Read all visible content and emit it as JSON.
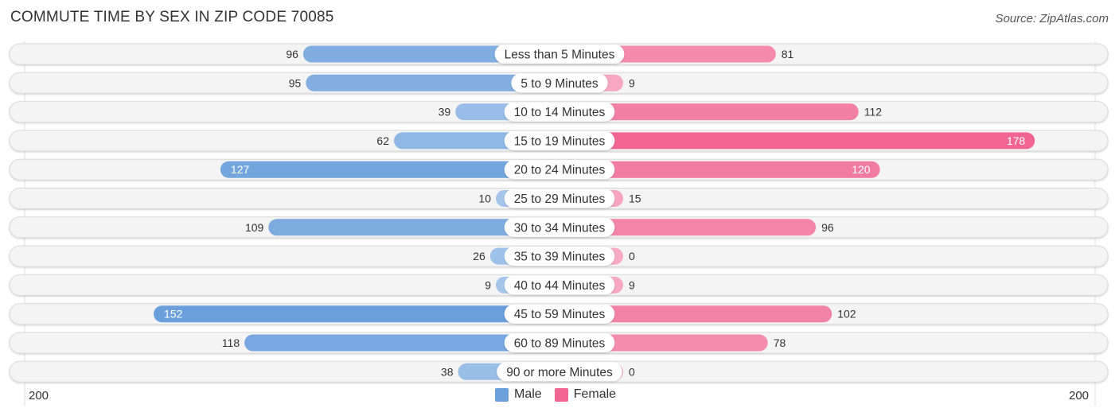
{
  "chart_data": {
    "type": "bar",
    "orientation": "horizontal-diverging",
    "title": "COMMUTE TIME BY SEX IN ZIP CODE 70085",
    "source": "Source: ZipAtlas.com",
    "categories": [
      "Less than 5 Minutes",
      "5 to 9 Minutes",
      "10 to 14 Minutes",
      "15 to 19 Minutes",
      "20 to 24 Minutes",
      "25 to 29 Minutes",
      "30 to 34 Minutes",
      "35 to 39 Minutes",
      "40 to 44 Minutes",
      "45 to 59 Minutes",
      "60 to 89 Minutes",
      "90 or more Minutes"
    ],
    "series": [
      {
        "name": "Male",
        "color": "#6a9fdb",
        "values": [
          96,
          95,
          39,
          62,
          127,
          10,
          109,
          26,
          9,
          152,
          118,
          38
        ]
      },
      {
        "name": "Female",
        "color": "#f06592",
        "values": [
          81,
          9,
          112,
          178,
          120,
          15,
          96,
          0,
          9,
          102,
          78,
          0
        ]
      }
    ],
    "axis": {
      "min_label": "200",
      "max_label": "200",
      "max": 200
    },
    "legend_position": "bottom-center"
  }
}
